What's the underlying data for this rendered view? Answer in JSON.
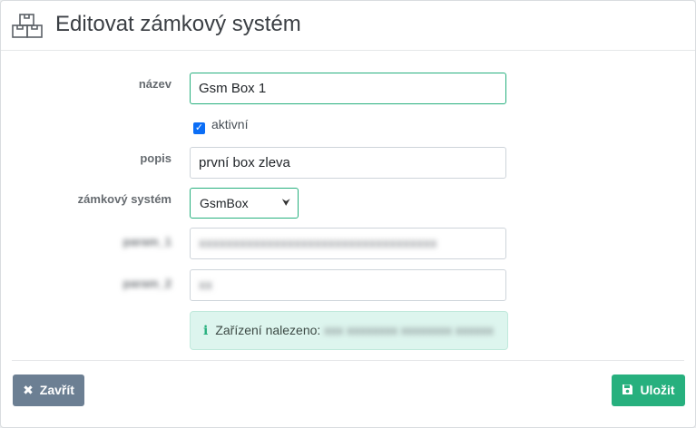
{
  "title": "Editovat zámkový systém",
  "form": {
    "name_label": "název",
    "name_value": "Gsm Box 1",
    "active_label": "aktivní",
    "active_checked": true,
    "description_label": "popis",
    "description_value": "první box zleva",
    "lock_system_label": "zámkový systém",
    "lock_system_value": "GsmBox",
    "param1_label": "param_1",
    "param1_value": "xxxxxxxxxxxxxxxxxxxxxxxxxxxxxxxxxxx",
    "param2_label": "param_2",
    "param2_value": "xx"
  },
  "alert": {
    "text": "Zařízení nalezeno:",
    "value": "xxx xxxxxxxx xxxxxxxx xxxxxx"
  },
  "buttons": {
    "close_label": "Zavřít",
    "save_label": "Uložit"
  }
}
